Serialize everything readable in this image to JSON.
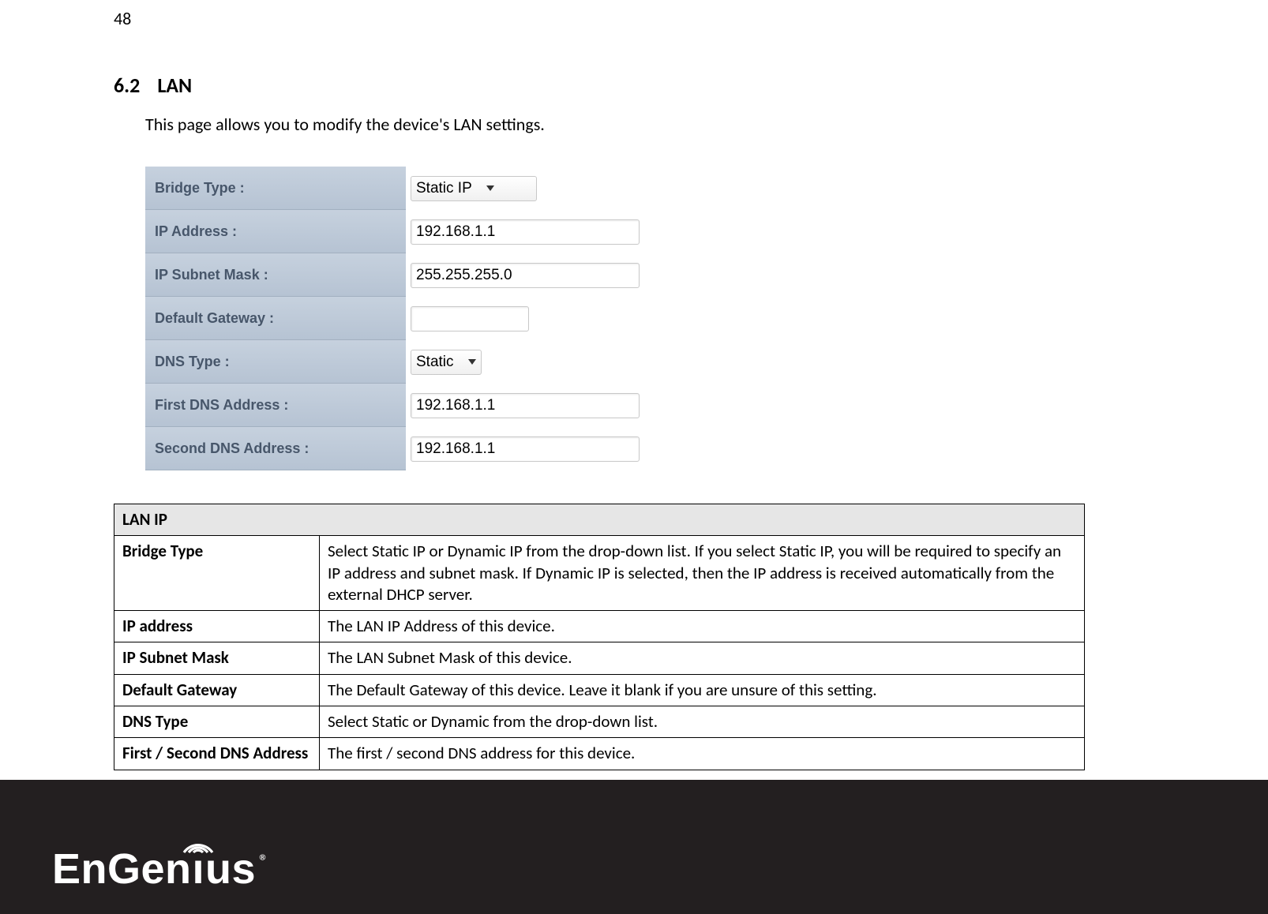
{
  "page_number": "48",
  "section": {
    "number": "6.2",
    "title": "LAN"
  },
  "intro": "This page allows you to modify the device's LAN settings.",
  "form": {
    "bridge_type": {
      "label": "Bridge Type :",
      "value": "Static IP"
    },
    "ip_address": {
      "label": "IP Address :",
      "value": "192.168.1.1"
    },
    "subnet_mask": {
      "label": "IP Subnet Mask :",
      "value": "255.255.255.0"
    },
    "gateway": {
      "label": "Default Gateway :",
      "value": ""
    },
    "dns_type": {
      "label": "DNS Type :",
      "value": "Static"
    },
    "dns1": {
      "label": "First DNS Address :",
      "value": "192.168.1.1"
    },
    "dns2": {
      "label": "Second DNS Address :",
      "value": "192.168.1.1"
    }
  },
  "table": {
    "header": "LAN IP",
    "rows": [
      {
        "label": "Bridge Type",
        "desc": "Select Static IP or Dynamic IP from the drop-down list. If you select Static IP, you will be required to specify an IP address and subnet mask. If Dynamic IP is selected, then the IP address is received automatically from the external DHCP server."
      },
      {
        "label": "IP address",
        "desc": "The LAN IP Address of this device."
      },
      {
        "label": "IP Subnet Mask",
        "desc": "The LAN Subnet Mask of this device."
      },
      {
        "label": "Default Gateway",
        "desc": "The Default Gateway of this device. Leave it blank if you are unsure of this setting."
      },
      {
        "label": "DNS Type",
        "desc": "Select Static or Dynamic from the drop-down list."
      },
      {
        "label": "First / Second DNS Address",
        "desc": "The first / second DNS address for this device."
      }
    ]
  },
  "logo": {
    "brand": "EnGenius",
    "reg": "®"
  }
}
